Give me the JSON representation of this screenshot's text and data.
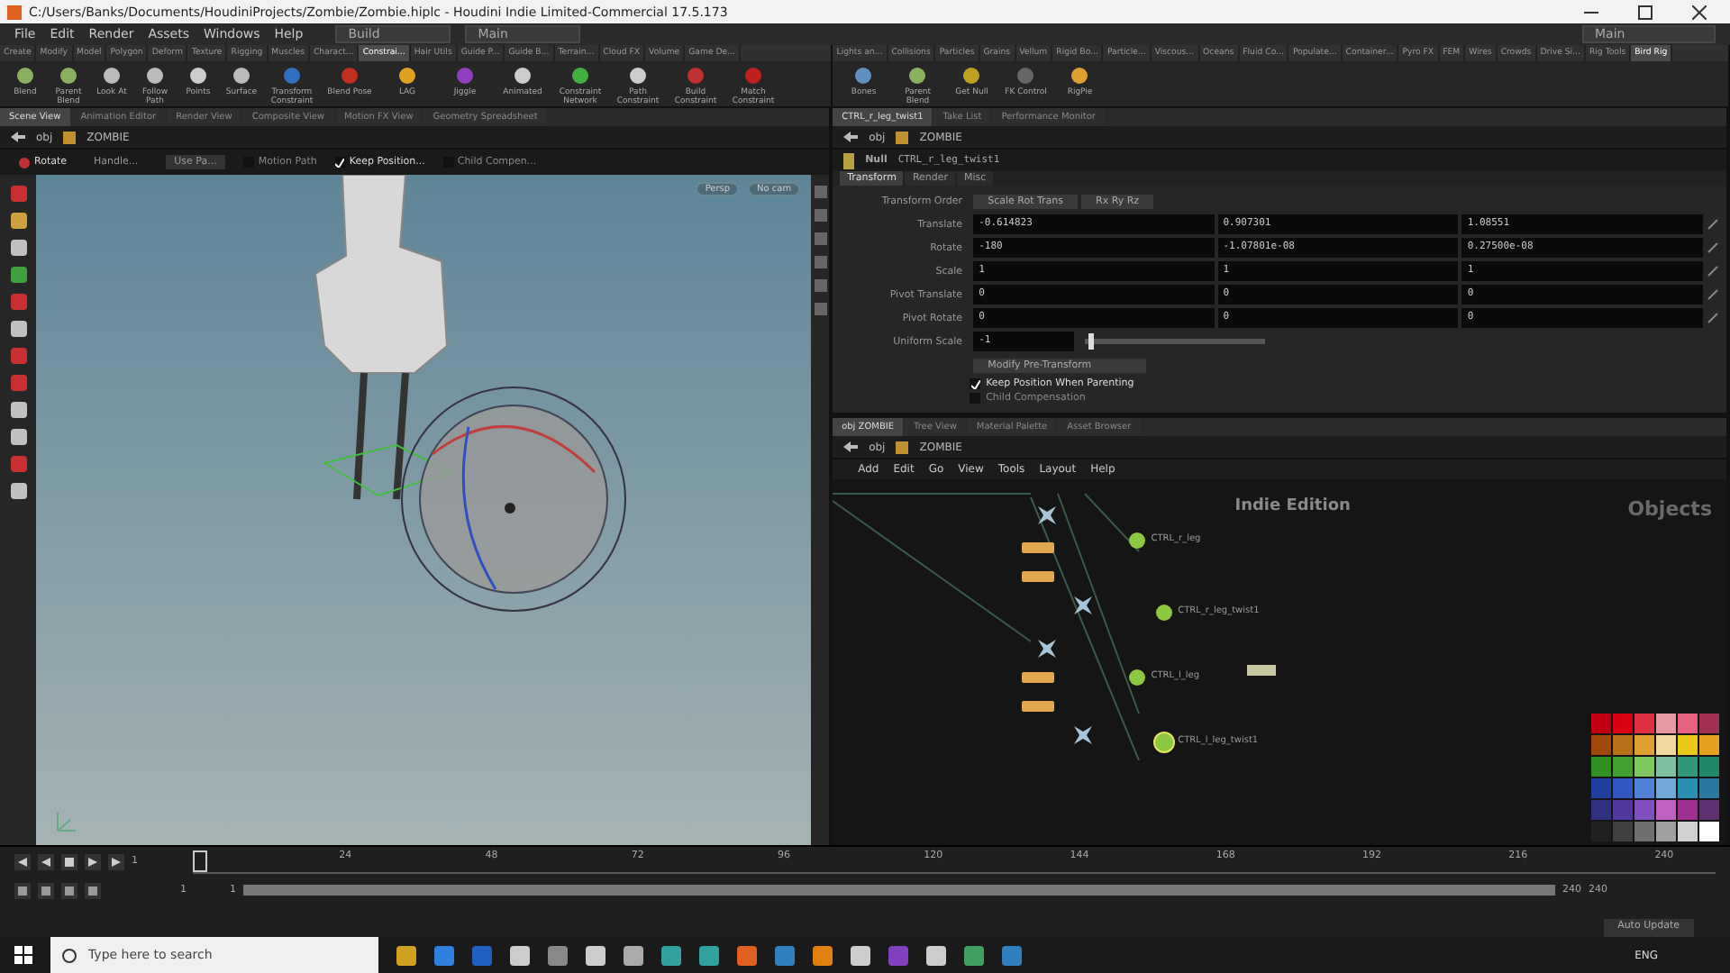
{
  "window": {
    "title": "C:/Users/Banks/Documents/HoudiniProjects/Zombie/Zombie.hiplc - Houdini Indie Limited-Commercial 17.5.173"
  },
  "menu": {
    "items": [
      "File",
      "Edit",
      "Render",
      "Assets",
      "Windows",
      "Help"
    ],
    "desktop": "Build",
    "desktop_center": "Main",
    "desktop_right": "Main"
  },
  "shelf_tabs_left": [
    {
      "label": "Create",
      "selected": false
    },
    {
      "label": "Modify",
      "selected": false
    },
    {
      "label": "Model",
      "selected": false
    },
    {
      "label": "Polygon",
      "selected": false
    },
    {
      "label": "Deform",
      "selected": false
    },
    {
      "label": "Texture",
      "selected": false
    },
    {
      "label": "Rigging",
      "selected": false
    },
    {
      "label": "Muscles",
      "selected": false
    },
    {
      "label": "Charact...",
      "selected": false
    },
    {
      "label": "Constrai...",
      "selected": true
    },
    {
      "label": "Hair Utils",
      "selected": false
    },
    {
      "label": "Guide P...",
      "selected": false
    },
    {
      "label": "Guide B...",
      "selected": false
    },
    {
      "label": "Terrain...",
      "selected": false
    },
    {
      "label": "Cloud FX",
      "selected": false
    },
    {
      "label": "Volume",
      "selected": false
    },
    {
      "label": "Game De...",
      "selected": false
    }
  ],
  "shelf_tools_left": [
    "Blend",
    "Parent Blend",
    "Look At",
    "Follow Path",
    "Points",
    "Surface",
    "Transform Constraint",
    "Blend Pose",
    "LAG",
    "Jiggle",
    "Animated",
    "Constraint Network",
    "Path Constraint",
    "Build Constraint",
    "Match Constraint"
  ],
  "shelf_tabs_right": [
    {
      "label": "Lights an...",
      "selected": false
    },
    {
      "label": "Collisions",
      "selected": false
    },
    {
      "label": "Particles",
      "selected": false
    },
    {
      "label": "Grains",
      "selected": false
    },
    {
      "label": "Vellum",
      "selected": false
    },
    {
      "label": "Rigid Bo...",
      "selected": false
    },
    {
      "label": "Particle...",
      "selected": false
    },
    {
      "label": "Viscous...",
      "selected": false
    },
    {
      "label": "Oceans",
      "selected": false
    },
    {
      "label": "Fluid Co...",
      "selected": false
    },
    {
      "label": "Populate...",
      "selected": false
    },
    {
      "label": "Container...",
      "selected": false
    },
    {
      "label": "Pyro FX",
      "selected": false
    },
    {
      "label": "FEM",
      "selected": false
    },
    {
      "label": "Wires",
      "selected": false
    },
    {
      "label": "Crowds",
      "selected": false
    },
    {
      "label": "Drive Si...",
      "selected": false
    },
    {
      "label": "Rig Tools",
      "selected": false
    },
    {
      "label": "Bird Rig",
      "selected": true
    }
  ],
  "shelf_tools_right": [
    "Bones",
    "Parent Blend",
    "Get Null",
    "FK Control",
    "RigPie"
  ],
  "scene_panel": {
    "tabs": [
      {
        "label": "Scene View",
        "selected": true
      },
      {
        "label": "Animation Editor",
        "selected": false
      },
      {
        "label": "Render View",
        "selected": false
      },
      {
        "label": "Composite View",
        "selected": false
      },
      {
        "label": "Motion FX View",
        "selected": false
      },
      {
        "label": "Geometry Spreadsheet",
        "selected": false
      }
    ],
    "path": [
      "obj",
      "ZOMBIE"
    ],
    "tool": "Rotate",
    "options": [
      {
        "label": "Handle...",
        "kind": "dropdown"
      },
      {
        "label": "Use Pa...",
        "kind": "dropdown"
      },
      {
        "label": "Motion Path",
        "kind": "toggle",
        "checked": false
      },
      {
        "label": "Keep Position...",
        "kind": "toggle",
        "checked": true
      },
      {
        "label": "Child Compen...",
        "kind": "toggle",
        "checked": false
      }
    ],
    "viewport": {
      "camera": "Persp",
      "display": "No cam"
    }
  },
  "parameter_panel": {
    "tabs": [
      {
        "label": "CTRL_r_leg_twist1",
        "selected": true
      },
      {
        "label": "Take List",
        "selected": false
      },
      {
        "label": "Performance Monitor",
        "selected": false
      }
    ],
    "path": [
      "obj",
      "ZOMBIE"
    ],
    "node_type": "Null",
    "node_name": "CTRL_r_leg_twist1",
    "param_tabs": [
      {
        "label": "Transform",
        "selected": true
      },
      {
        "label": "Render",
        "selected": false
      },
      {
        "label": "Misc",
        "selected": false
      }
    ],
    "transform_order": {
      "label": "Transform Order",
      "values": [
        "Scale Rot Trans",
        "Rx Ry Rz"
      ]
    },
    "rows": [
      {
        "label": "Translate",
        "values": [
          "-0.614823",
          "0.907301",
          "1.08551"
        ]
      },
      {
        "label": "Rotate",
        "values": [
          "-180",
          "-1.07801e-08",
          "0.27500e-08"
        ]
      },
      {
        "label": "Scale",
        "values": [
          "1",
          "1",
          "1"
        ]
      },
      {
        "label": "Pivot Translate",
        "values": [
          "0",
          "0",
          "0"
        ]
      },
      {
        "label": "Pivot Rotate",
        "values": [
          "0",
          "0",
          "0"
        ]
      }
    ],
    "uniform_scale": {
      "label": "Uniform Scale",
      "value": "-1",
      "level": 0.02
    },
    "pre_transform": "Modify Pre-Transform",
    "checks": [
      {
        "label": "Keep Position When Parenting",
        "checked": true
      },
      {
        "label": "Child Compensation",
        "checked": false
      }
    ]
  },
  "network_panel": {
    "tabs": [
      {
        "label": "obj ZOMBIE",
        "selected": true
      },
      {
        "label": "Tree View",
        "selected": false
      },
      {
        "label": "Material Palette",
        "selected": false
      },
      {
        "label": "Asset Browser",
        "selected": false
      }
    ],
    "path": [
      "obj",
      "ZOMBIE"
    ],
    "menu": [
      "Add",
      "Edit",
      "Go",
      "View",
      "Tools",
      "Layout",
      "Help"
    ],
    "edition": "Indie Edition",
    "context": "Objects",
    "nodes": [
      {
        "kind": "bone"
      },
      {
        "kind": "null"
      },
      {
        "kind": "null"
      },
      {
        "kind": "ctrl",
        "label": "CTRL_r_leg",
        "selected": false
      },
      {
        "kind": "bone"
      },
      {
        "kind": "ctrl",
        "label": "CTRL_r_leg_twist1",
        "selected": false
      },
      {
        "kind": "bone"
      },
      {
        "kind": "null"
      },
      {
        "kind": "null"
      },
      {
        "kind": "ctrl",
        "label": "CTRL_l_leg",
        "selected": false
      },
      {
        "kind": "bone"
      },
      {
        "kind": "ctrl",
        "label": "CTRL_l_leg_twist1",
        "selected": true
      },
      {
        "kind": "geo"
      }
    ]
  },
  "timeline": {
    "frame": "1",
    "ticks": [
      "24",
      "48",
      "72",
      "96",
      "120",
      "144",
      "168",
      "192",
      "216",
      "240"
    ],
    "level": 0.0,
    "range": {
      "start": "1",
      "start2": "1",
      "end": "240",
      "end2": "240",
      "level": 1
    },
    "auto_update": "Auto Update"
  },
  "taskbar": {
    "search": "Type here to search",
    "lang": "ENG"
  }
}
